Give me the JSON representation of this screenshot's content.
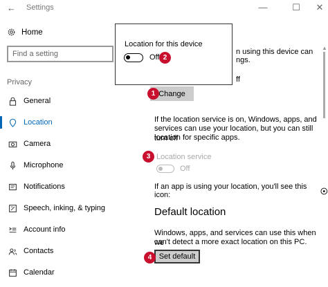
{
  "window": {
    "title": "Settings",
    "back_glyph": "←",
    "minimize_glyph": "—",
    "maximize_glyph": "☐",
    "close_glyph": "✕"
  },
  "sidebar": {
    "home_label": "Home",
    "search_placeholder": "Find a setting",
    "section_label": "Privacy",
    "items": [
      {
        "label": "General",
        "icon": "lock-icon"
      },
      {
        "label": "Location",
        "icon": "location-icon",
        "active": true
      },
      {
        "label": "Camera",
        "icon": "camera-icon"
      },
      {
        "label": "Microphone",
        "icon": "microphone-icon"
      },
      {
        "label": "Notifications",
        "icon": "notifications-icon"
      },
      {
        "label": "Speech, inking, & typing",
        "icon": "speech-icon"
      },
      {
        "label": "Account info",
        "icon": "account-info-icon"
      },
      {
        "label": "Contacts",
        "icon": "contacts-icon"
      },
      {
        "label": "Calendar",
        "icon": "calendar-icon"
      }
    ]
  },
  "main": {
    "partial_line_1": "n using this device can",
    "partial_line_2": "ngs.",
    "partial_line_3": "ff",
    "change_label": "Change",
    "service_desc_1": "If the location service is on, Windows, apps, and",
    "service_desc_2": "services can use your location, but you can still turn off",
    "service_desc_3": "location for specific apps.",
    "location_service_label": "Location service",
    "location_service_state": "Off",
    "icon_info_text": "If an app is using your location, you'll see this icon:",
    "default_location_heading": "Default location",
    "default_desc_1": "Windows, apps, and services can use this when we",
    "default_desc_2": "can't detect a more exact location on this PC.",
    "set_default_label": "Set default"
  },
  "popup": {
    "title": "Location for this device",
    "state": "Off"
  },
  "badges": [
    "1",
    "2",
    "3",
    "4"
  ],
  "colors": {
    "accent": "#0067b8",
    "badge": "#c8102e",
    "button_bg": "#cccccc"
  }
}
